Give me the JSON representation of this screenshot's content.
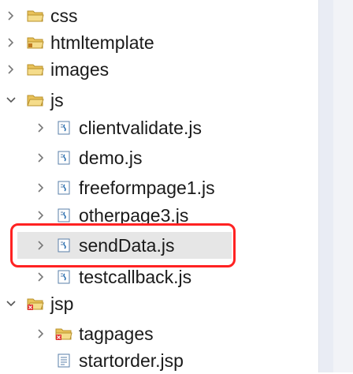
{
  "tree": {
    "items": [
      {
        "label": "css",
        "kind": "folder",
        "expanded": false
      },
      {
        "label": "htmltemplate",
        "kind": "folder-package",
        "expanded": false
      },
      {
        "label": "images",
        "kind": "folder",
        "expanded": false
      },
      {
        "label": "js",
        "kind": "folder",
        "expanded": true
      },
      {
        "label": "clientvalidate.js",
        "kind": "js-file",
        "expanded": false
      },
      {
        "label": "demo.js",
        "kind": "js-file",
        "expanded": false
      },
      {
        "label": "freeformpage1.js",
        "kind": "js-file",
        "expanded": false
      },
      {
        "label": "otherpage3.js",
        "kind": "js-file",
        "expanded": false
      },
      {
        "label": "sendData.js",
        "kind": "js-file",
        "expanded": false,
        "selected": true
      },
      {
        "label": "testcallback.js",
        "kind": "js-file",
        "expanded": false
      },
      {
        "label": "jsp",
        "kind": "folder-error",
        "expanded": true
      },
      {
        "label": "tagpages",
        "kind": "folder-error",
        "expanded": false
      },
      {
        "label": "startorder.jsp",
        "kind": "file",
        "expanded": false
      }
    ]
  },
  "colors": {
    "highlight": "#ff2222",
    "folder": "#e9c25a",
    "js_icon": "#2a6fb0",
    "error": "#e03030"
  }
}
